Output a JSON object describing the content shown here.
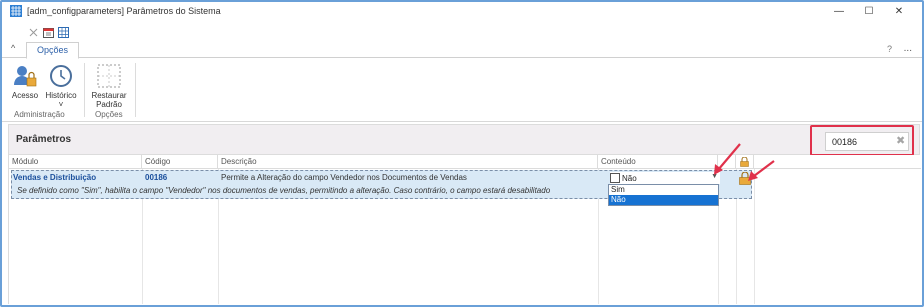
{
  "window": {
    "title": "[adm_configparameters] Parâmetros do Sistema",
    "controls": {
      "minimize": "—",
      "maximize": "☐",
      "close": "✕"
    }
  },
  "ribbon": {
    "tab": "Opções",
    "collapse": "^",
    "help": "?",
    "more": "...",
    "buttons": {
      "acesso": "Acesso",
      "historico": "Histórico",
      "historico_dropdown": "˅",
      "restaurar_line1": "Restaurar",
      "restaurar_line2": "Padrão"
    },
    "groups": {
      "administracao": "Administração",
      "opcoes": "Opções"
    }
  },
  "panel": {
    "title": "Parâmetros",
    "search_value": "00186",
    "clear_icon": "✖"
  },
  "grid": {
    "columns": {
      "modulo": "Módulo",
      "codigo": "Código",
      "descricao": "Descrição",
      "conteudo": "Conteúdo"
    },
    "row": {
      "modulo": "Vendas e Distribuição",
      "codigo": "00186",
      "descricao": "Permite a Alteração do campo Vendedor nos Documentos de Vendas",
      "detail": "Se definido como \"Sim\", habilita o campo \"Vendedor\" nos documentos de vendas, permitindo a alteração. Caso contrário, o campo estará desabilitado",
      "conteudo": "Não"
    },
    "dropdown_options": [
      "Sim",
      "Não"
    ],
    "selected_option": "Não"
  },
  "colors": {
    "accent": "#1672d2",
    "highlight_box": "#e0314b",
    "row_selected": "#d9e9f6",
    "arrow": "#e0314b"
  },
  "icons": [
    "app-grid-icon",
    "acesso-user-lock-icon",
    "historico-clock-icon",
    "restaurar-padrao-icon",
    "lock-icon",
    "clear-icon"
  ]
}
